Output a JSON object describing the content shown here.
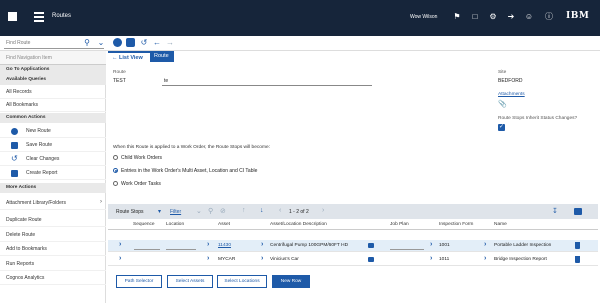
{
  "header": {
    "app_title": "Routes",
    "user": "Wow Wilson",
    "brand": "IBM"
  },
  "toolbar": {
    "find_placeholder": "Find Route"
  },
  "sidebar": {
    "find_placeholder": "Find Navigation Item",
    "sections": [
      {
        "title": "Go To Applications"
      },
      {
        "title": "Available Queries"
      },
      {
        "title": "Common Actions"
      },
      {
        "title": "More Actions"
      }
    ],
    "queries": [
      {
        "label": "All Records"
      },
      {
        "label": "All Bookmarks"
      }
    ],
    "common_actions": [
      {
        "label": "New Route",
        "icon": "plus-circle-icon"
      },
      {
        "label": "Save Route",
        "icon": "save-icon"
      },
      {
        "label": "Clear Changes",
        "icon": "undo-icon"
      },
      {
        "label": "Create Report",
        "icon": "report-icon"
      }
    ],
    "more_actions": [
      {
        "label": "Attachment Library/Folders"
      },
      {
        "label": "Duplicate Route"
      },
      {
        "label": "Delete Route"
      },
      {
        "label": "Add to Bookmarks"
      },
      {
        "label": "Run Reports"
      },
      {
        "label": "Cognos Analytics"
      }
    ]
  },
  "tabs": [
    {
      "label": "List View"
    },
    {
      "label": "Route"
    }
  ],
  "form": {
    "route_label": "Route",
    "route_value": "TEST",
    "description_value": "te",
    "site_label": "Site",
    "site_value": "BEDFORD",
    "attachments_label": "Attachments",
    "inherit_label": "Route Stops Inherit Status Changes?",
    "inherit_checked": true,
    "applied_label": "When this Route is applied to a Work Order, the Route Stops will become:",
    "options": [
      {
        "label": "Child Work Orders",
        "checked": false
      },
      {
        "label": "Entries in the Work Order's Multi Asset, Location and CI Table",
        "checked": true
      },
      {
        "label": "Work Order Tasks",
        "checked": false
      }
    ]
  },
  "table": {
    "title": "Route Stops",
    "filter_label": "Filter",
    "pagination": "1 - 2 of 2",
    "columns": [
      "Sequence",
      "Location",
      "Asset",
      "Asset/Location Description",
      "Job Plan",
      "Inspection Form",
      "Name"
    ],
    "rows": [
      {
        "sequence": "",
        "location": "",
        "asset": "11430",
        "description": "Centrifugal Pump 100GPM/60FT HD",
        "job_plan": "",
        "form": "1001",
        "name": "Portable Ladder Inspection"
      },
      {
        "sequence": "",
        "location": "",
        "asset": "MYCAR",
        "description": "Vinicius's Car",
        "job_plan": "",
        "form": "1011",
        "name": "Bridge Inspection Report"
      }
    ]
  },
  "buttons": [
    {
      "label": "Path Selector"
    },
    {
      "label": "Select Assets"
    },
    {
      "label": "Select Locations"
    },
    {
      "label": "New Row"
    }
  ],
  "colors": {
    "header_bg": "#16253a",
    "accent": "#1e5aa8"
  }
}
